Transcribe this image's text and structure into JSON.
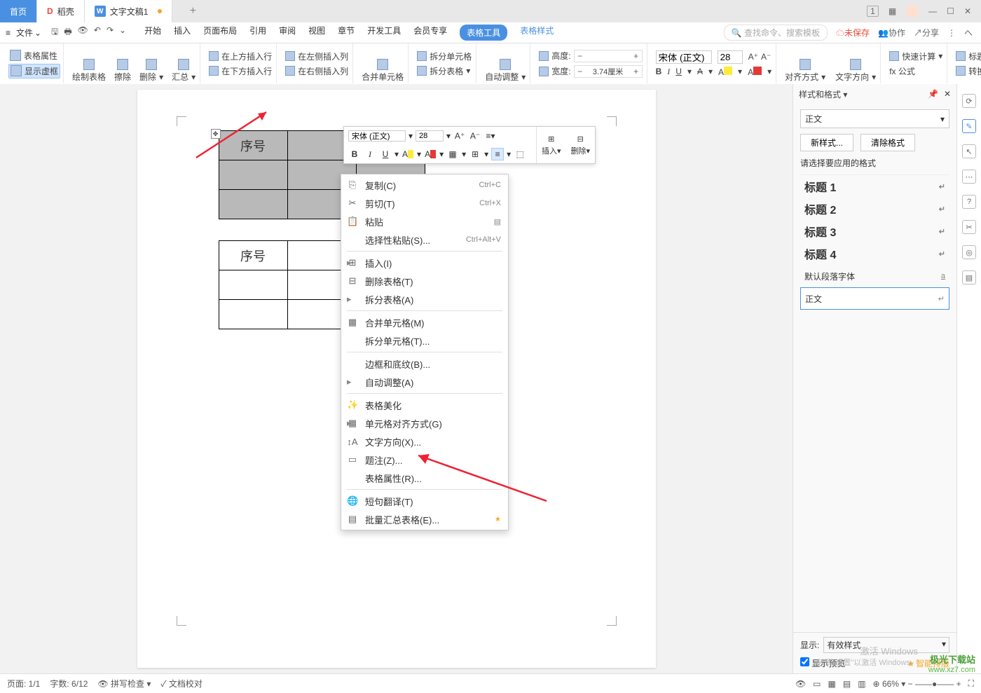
{
  "tabs": {
    "home": "首页",
    "docer": "稻壳",
    "doc": "文字文稿1"
  },
  "window": {
    "box_num": "1"
  },
  "file_label": "文件",
  "menu": [
    "开始",
    "插入",
    "页面布局",
    "引用",
    "审阅",
    "视图",
    "章节",
    "开发工具",
    "会员专享"
  ],
  "menu_active": "表格工具",
  "menu_link": "表格样式",
  "search_placeholder": "查找命令、搜索模板",
  "top_right": {
    "unsaved": "未保存",
    "coop": "协作",
    "share": "分享"
  },
  "ribbon": {
    "prop": "表格属性",
    "show_virtual": "显示虚框",
    "draw": "绘制表格",
    "erase": "擦除",
    "delete": "删除",
    "summary": "汇总",
    "ins_row_above": "在上方插入行",
    "ins_row_below": "在下方插入行",
    "ins_col_left": "在左侧插入列",
    "ins_col_right": "在右侧插入列",
    "merge": "合并单元格",
    "split_cell": "拆分单元格",
    "split_table": "拆分表格",
    "auto_adjust": "自动调整",
    "height": "高度:",
    "width": "宽度:",
    "width_val": "3.74厘米",
    "font_name": "宋体 (正文)",
    "font_size": "28",
    "align": "对齐方式",
    "text_dir": "文字方向",
    "quick_calc": "快速计算",
    "title_repeat": "标题行重",
    "formula": "fx 公式",
    "convert": "转换成"
  },
  "mini": {
    "font_name": "宋体 (正文)",
    "font_size": "28",
    "insert": "插入",
    "delete": "删除"
  },
  "table_header": "序号",
  "ctx": {
    "copy": "复制(C)",
    "copy_k": "Ctrl+C",
    "cut": "剪切(T)",
    "cut_k": "Ctrl+X",
    "paste": "粘贴",
    "paste_special": "选择性粘贴(S)...",
    "paste_special_k": "Ctrl+Alt+V",
    "insert": "插入(I)",
    "del_table": "删除表格(T)",
    "split_table": "拆分表格(A)",
    "merge_cell": "合并单元格(M)",
    "split_cell": "拆分单元格(T)...",
    "border": "边框和底纹(B)...",
    "auto_adj": "自动调整(A)",
    "beautify": "表格美化",
    "cell_align": "单元格对齐方式(G)",
    "text_dir": "文字方向(X)...",
    "caption": "题注(Z)...",
    "table_prop": "表格属性(R)...",
    "translate": "短句翻译(T)",
    "batch_sum": "批量汇总表格(E)..."
  },
  "style_panel": {
    "title": "样式和格式",
    "current": "正文",
    "new_style": "新样式...",
    "clear": "清除格式",
    "hint": "请选择要应用的格式",
    "h1": "标题 1",
    "h2": "标题 2",
    "h3": "标题 3",
    "h4": "标题 4",
    "default_font": "默认段落字体",
    "body": "正文",
    "display": "显示:",
    "effective": "有效样式",
    "preview": "显示预览",
    "smart": "智能排版"
  },
  "status": {
    "page": "页面: 1/1",
    "words": "字数: 6/12",
    "spell": "拼写检查",
    "proof": "文档校对",
    "zoom": "66%"
  },
  "activate": {
    "l1": "激活 Windows",
    "l2": "转到\"设置\"以激活 Windows。"
  },
  "logo": {
    "l1": "极光下载站",
    "l2": "www.xz7.com"
  }
}
